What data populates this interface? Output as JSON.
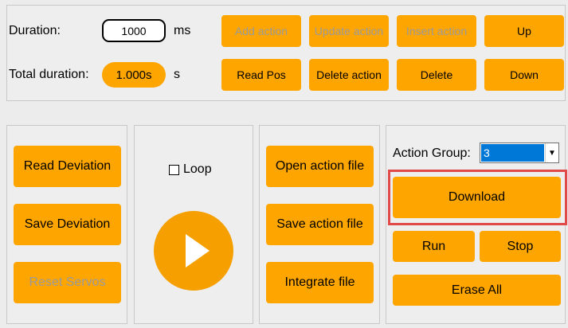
{
  "top": {
    "duration_label": "Duration:",
    "duration_value": "1000",
    "duration_unit": "ms",
    "total_label": "Total duration:",
    "total_value": "1.000s",
    "total_unit": "s",
    "buttons": {
      "add_action": "Add action",
      "update_action": "Update action",
      "insert_action": "Insert action",
      "up": "Up",
      "read_pos": "Read Pos",
      "delete_action": "Delete action",
      "delete": "Delete",
      "down": "Down"
    }
  },
  "deviation": {
    "read": "Read Deviation",
    "save": "Save Deviation",
    "reset": "Reset Servos"
  },
  "playback": {
    "loop_label": "Loop",
    "loop_checked": false
  },
  "files": {
    "open": "Open action file",
    "save": "Save action file",
    "integrate": "Integrate file"
  },
  "group": {
    "label": "Action Group:",
    "selected": "3",
    "download": "Download",
    "run": "Run",
    "stop": "Stop",
    "erase": "Erase All"
  },
  "colors": {
    "accent": "#ffa500",
    "highlight": "#e04a4a",
    "selection": "#0078d7"
  }
}
